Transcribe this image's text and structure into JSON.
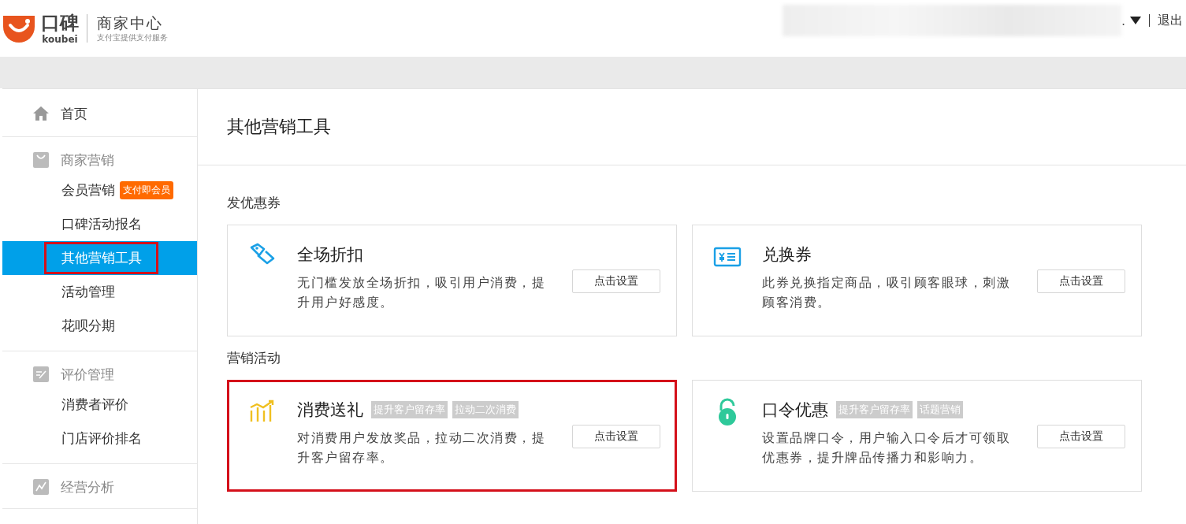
{
  "header": {
    "logo_text": "口碑",
    "logo_sub": "koubei",
    "center_title": "商家中心",
    "center_sub": "支付宝提供支付服务",
    "user_tail": ".",
    "logout": "退出"
  },
  "sidebar": {
    "groups": [
      {
        "kind": "link",
        "label": "首页"
      },
      {
        "kind": "group",
        "label": "商家营销",
        "children": [
          {
            "label": "会员营销",
            "badge": "支付即会员",
            "selected": false,
            "highlighted": false
          },
          {
            "label": "口碑活动报名",
            "selected": false,
            "highlighted": false
          },
          {
            "label": "其他营销工具",
            "selected": true,
            "highlighted": true
          },
          {
            "label": "活动管理",
            "selected": false,
            "highlighted": false
          },
          {
            "label": "花呗分期",
            "selected": false,
            "highlighted": false
          }
        ]
      },
      {
        "kind": "group",
        "label": "评价管理",
        "children": [
          {
            "label": "消费者评价",
            "selected": false,
            "highlighted": false
          },
          {
            "label": "门店评价排名",
            "selected": false,
            "highlighted": false
          }
        ]
      },
      {
        "kind": "group",
        "label": "经营分析"
      }
    ]
  },
  "main": {
    "title": "其他营销工具",
    "sections": [
      {
        "heading": "发优惠券",
        "cards": [
          {
            "title": "全场折扣",
            "description": "无门槛发放全场折扣，吸引用户消费，提升用户好感度。",
            "button": "点击设置",
            "highlighted": false
          },
          {
            "title": "兑换券",
            "description": "此券兑换指定商品，吸引顾客眼球，刺激顾客消费。",
            "button": "点击设置",
            "highlighted": false
          }
        ]
      },
      {
        "heading": "营销活动",
        "cards": [
          {
            "title": "消费送礼",
            "tags": [
              "提升客户留存率",
              "拉动二次消费"
            ],
            "description": "对消费用户发放奖品，拉动二次消费，提升客户留存率。",
            "button": "点击设置",
            "highlighted": true
          },
          {
            "title": "口令优惠",
            "tags": [
              "提升客户留存率",
              "话题营销"
            ],
            "description": "设置品牌口令，用户输入口令后才可领取优惠券，提升牌品传播力和影响力。",
            "button": "点击设置",
            "highlighted": false
          }
        ]
      }
    ]
  }
}
